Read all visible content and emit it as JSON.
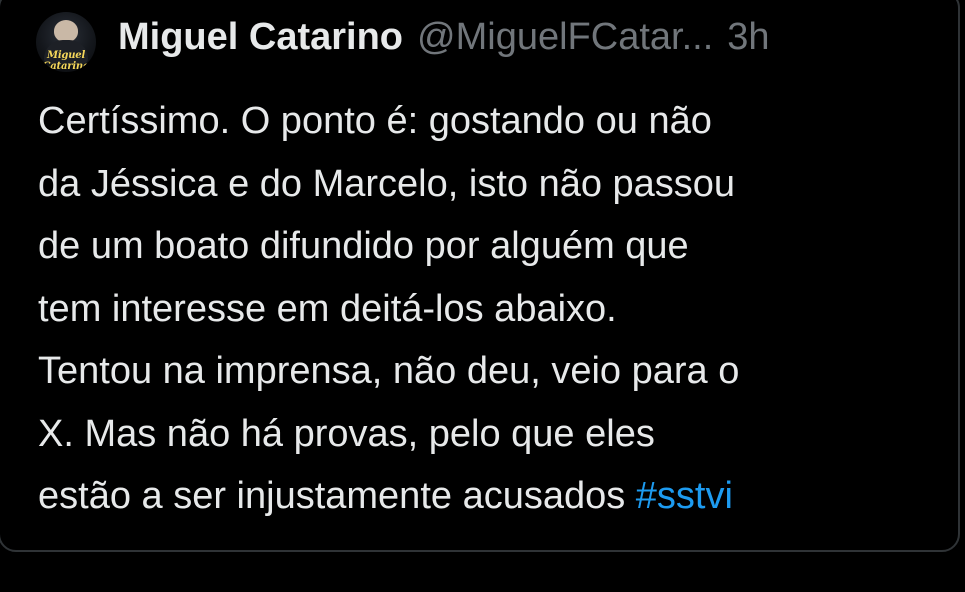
{
  "tweet": {
    "author": {
      "display_name": "Miguel Catarino",
      "handle": "@MiguelFCatar...",
      "avatar_icon": "profile-photo-with-logo"
    },
    "time": "3h",
    "text_lines": [
      "Certíssimo. O ponto é: gostando ou não",
      "da Jéssica e do Marcelo, isto não passou",
      "de um boato difundido por alguém que",
      "tem interesse em deitá-los abaixo.",
      "Tentou na imprensa, não deu, veio para o",
      "X. Mas não há provas, pelo que eles",
      "estão a ser injustamente acusados "
    ],
    "hashtag": "#sstvi"
  },
  "colors": {
    "background": "#000000",
    "primary_text": "#e7e9ea",
    "secondary_text": "#71767b",
    "link": "#1d9bf0",
    "border": "#2f3336"
  }
}
